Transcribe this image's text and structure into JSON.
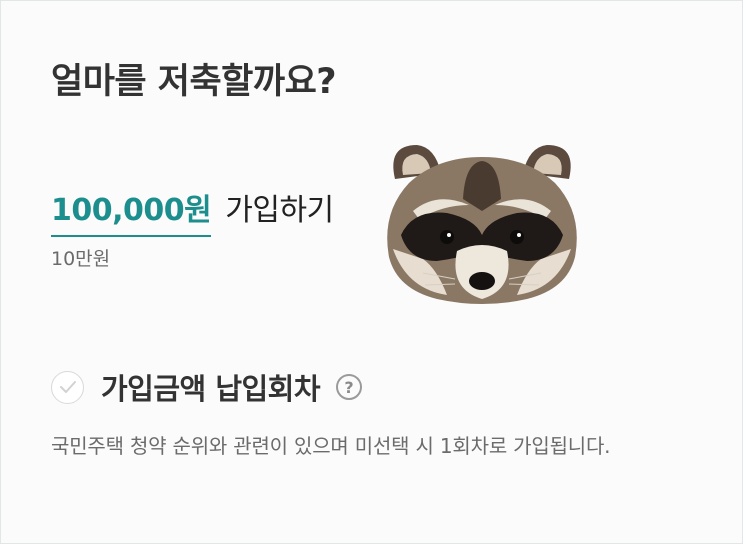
{
  "title": "얼마를 저축할까요?",
  "amount": {
    "value": "100,000원",
    "suffix": "가입하기",
    "sub": "10만원"
  },
  "option": {
    "label": "가입금액 납입회차",
    "help_icon": "question-circle-icon",
    "check_icon": "check-circle-icon",
    "checked": false
  },
  "description": "국민주택 청약 순위와 관련이 있으며 미선택 시 1회차로 가입됩니다.",
  "colors": {
    "accent": "#1c8e8e",
    "title": "#333333",
    "muted": "#6b6b6b",
    "background": "#fbfbfb"
  }
}
